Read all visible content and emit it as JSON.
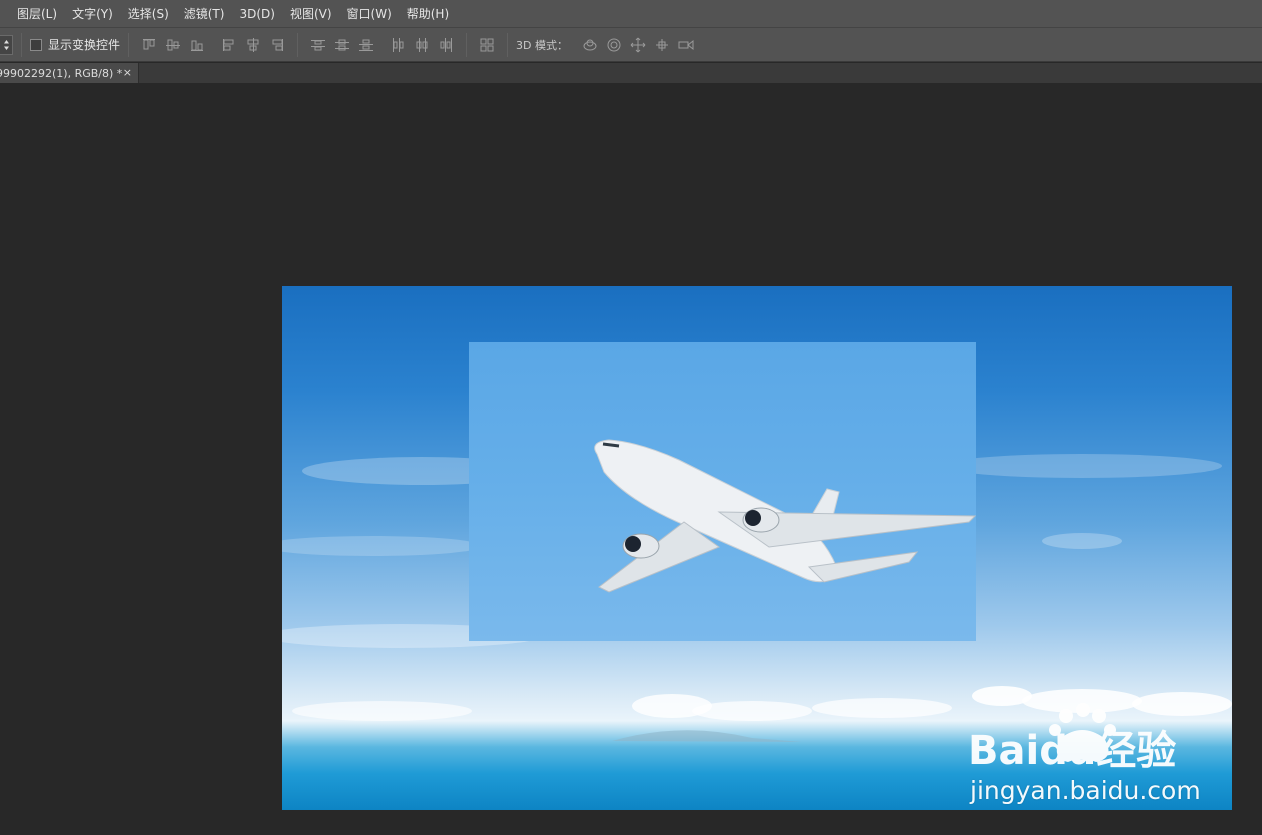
{
  "menu": {
    "items": [
      "图层(L)",
      "文字(Y)",
      "选择(S)",
      "滤镜(T)",
      "3D(D)",
      "视图(V)",
      "窗口(W)",
      "帮助(H)"
    ]
  },
  "options": {
    "show_transform_label": "显示变换控件",
    "mode_3d_label": "3D 模式："
  },
  "document": {
    "tab_title": "99902292(1), RGB/8) *",
    "close_glyph": "×"
  },
  "watermark": {
    "url_text": "jingyan.baidu.com",
    "logo_text": "Baidu经验"
  },
  "icons": {
    "align_group_1": [
      "align-top-edges-icon",
      "align-vertical-centers-icon",
      "align-bottom-edges-icon"
    ],
    "align_group_2": [
      "align-left-edges-icon",
      "align-horizontal-centers-icon",
      "align-right-edges-icon"
    ],
    "distribute_group_1": [
      "distribute-top-icon",
      "distribute-vcenter-icon",
      "distribute-bottom-icon"
    ],
    "distribute_group_2": [
      "distribute-left-icon",
      "distribute-hcenter-icon",
      "distribute-right-icon"
    ],
    "auto_align_icon": "auto-align-layers-icon",
    "mode_3d_icons": [
      "rotate-3d-icon",
      "roll-3d-icon",
      "drag-3d-icon",
      "slide-3d-icon",
      "scale-3d-icon"
    ]
  }
}
